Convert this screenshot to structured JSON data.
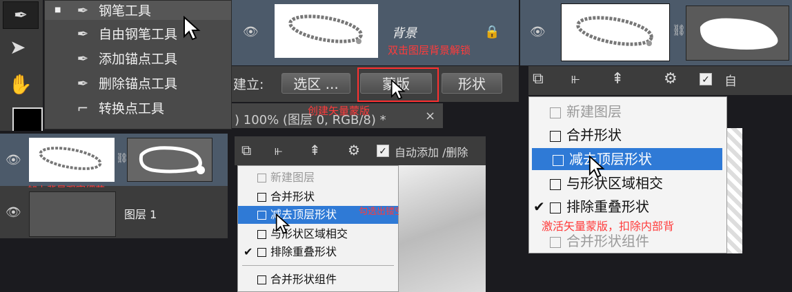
{
  "tool_menu": {
    "items": [
      {
        "label": "钢笔工具",
        "icon": "pen-icon",
        "bullet": "■"
      },
      {
        "label": "自由钢笔工具",
        "icon": "freeform-pen-icon",
        "bullet": ""
      },
      {
        "label": "添加锚点工具",
        "icon": "add-anchor-icon",
        "bullet": ""
      },
      {
        "label": "删除锚点工具",
        "icon": "delete-anchor-icon",
        "bullet": ""
      },
      {
        "label": "转换点工具",
        "icon": "convert-point-icon",
        "bullet": ""
      }
    ]
  },
  "layers_top": {
    "background_layer_name": "背景",
    "unlock_note": "双击图层背景解锁"
  },
  "options_bar": {
    "make_label": "建立:",
    "selection_btn": "选区 ...",
    "mask_btn": "蒙版",
    "shape_btn": "形状",
    "mask_note": "创建矢量蒙版"
  },
  "doc_tab": {
    "title": ") 100% (图层 0, RGB/8) *",
    "close": "×"
  },
  "layers_left": {
    "add_bg_note": "加上背景观察细节",
    "layer1_name": "图层 1"
  },
  "path_toolbar": {
    "auto_add_label": "自动添加 /删除",
    "auto_add_short": "自"
  },
  "path_ops_menu": {
    "items": [
      {
        "label": "新建图层",
        "state": "disabled",
        "check": ""
      },
      {
        "label": "合并形状",
        "state": "normal",
        "check": ""
      },
      {
        "label": "减去顶层形状",
        "state": "selected",
        "check": ""
      },
      {
        "label": "与形状区域相交",
        "state": "normal",
        "check": ""
      },
      {
        "label": "排除重叠形状",
        "state": "normal",
        "check": "✔"
      },
      {
        "label": "合并形状组件",
        "state": "normal",
        "check": ""
      }
    ],
    "right_items": [
      {
        "label": "新建图层",
        "state": "disabled",
        "check": ""
      },
      {
        "label": "合并形状",
        "state": "normal",
        "check": ""
      },
      {
        "label": "减去顶层形状",
        "state": "selected",
        "check": ""
      },
      {
        "label": "与形状区域相交",
        "state": "normal",
        "check": ""
      },
      {
        "label": "排除重叠形状",
        "state": "normal",
        "check": "✔"
      },
      {
        "label": "合并形状组件",
        "state": "disabled",
        "check": ""
      }
    ],
    "middle_note": "勾选出镂空作精确区",
    "right_note": "激活矢量蒙版，扣除内部背"
  },
  "colors": {
    "red": "#ff3b3b",
    "selected": "#2f7ad6",
    "panel": "#4a4a4a"
  }
}
